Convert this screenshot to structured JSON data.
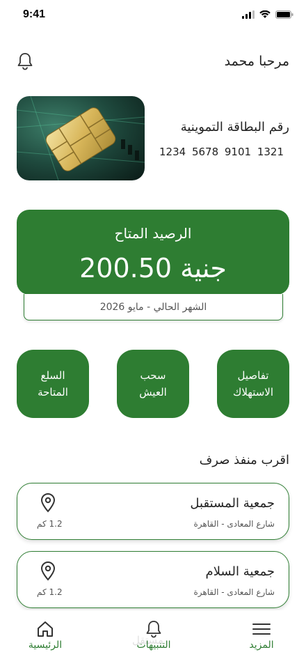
{
  "status_bar": {
    "time": "9:41"
  },
  "header": {
    "greeting": "مرحبا محمد"
  },
  "card": {
    "label": "رقم البطاقة التموينية",
    "number": "1234  5678  9101  1321"
  },
  "balance": {
    "title": "الرصيد المتاح",
    "amount": "200.50",
    "currency": "جنية",
    "month": "الشهر الحالي - مايو 2026"
  },
  "quick_actions": [
    {
      "label": "تفاصيل\nالاستهلاك"
    },
    {
      "label": "سحب\nالعيش"
    },
    {
      "label": "السلع\nالمتاحة"
    }
  ],
  "outlets": {
    "title": "اقرب منفذ صرف",
    "items": [
      {
        "name": "جمعية المستقبل",
        "address": "شارع المعادى - القاهرة",
        "distance": "1.2 كم"
      },
      {
        "name": "جمعية السلام",
        "address": "شارع المعادى - القاهرة",
        "distance": "1.2 كم"
      }
    ]
  },
  "nav": {
    "more": "المزيد",
    "alerts": "التنبيهات",
    "home": "الرئيسية"
  },
  "watermark": "مستقل",
  "colors": {
    "primary": "#2e7d32",
    "card_bg": "#1f3b34"
  },
  "icons": [
    "bell-icon",
    "location-pin-icon",
    "menu-icon",
    "home-icon",
    "signal-icon",
    "wifi-icon",
    "battery-icon"
  ]
}
